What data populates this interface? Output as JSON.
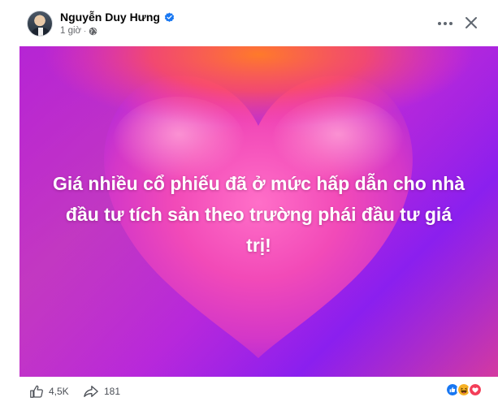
{
  "post": {
    "author_name": "Nguyễn Duy Hưng",
    "timestamp": "1 giờ",
    "separator": "·",
    "privacy_icon": "globe-icon",
    "verified_icon": "verified-badge-icon",
    "content_text": "Giá nhiều cổ phiếu đã ở mức hấp dẫn cho nhà đầu tư tích sản theo trường phái đầu tư giá trị!",
    "background": "heart-gradient"
  },
  "header": {
    "more_icon": "more-options-icon",
    "close_icon": "close-icon"
  },
  "footer": {
    "like_count": "4,5K",
    "share_count": "181",
    "like_icon": "like-icon",
    "share_icon": "share-icon",
    "reaction_icons": [
      "like-reaction-icon",
      "haha-reaction-icon",
      "love-reaction-icon"
    ]
  },
  "colors": {
    "accent": "#1877f2",
    "love": "#f33e58",
    "haha": "#f7b125",
    "text_primary": "#050505",
    "text_secondary": "#65676b"
  }
}
